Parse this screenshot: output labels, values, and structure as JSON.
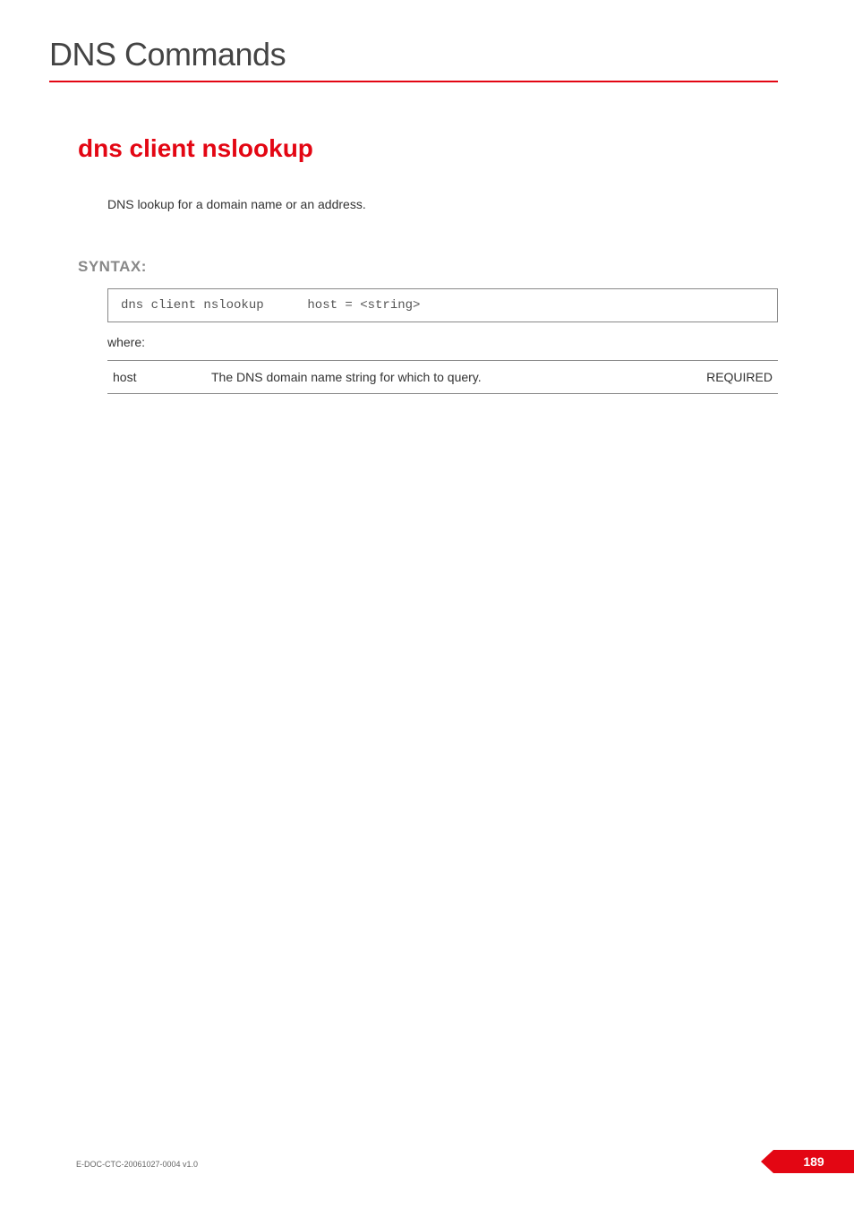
{
  "header": {
    "title": "DNS Commands"
  },
  "section": {
    "title": "dns client nslookup",
    "description": "DNS lookup for a domain name or an address."
  },
  "syntax": {
    "label": "SYNTAX:",
    "command": "dns client nslookup",
    "parameter": "host = <string>",
    "where_label": "where:"
  },
  "params": [
    {
      "name": "host",
      "description": "The DNS domain name string for which to query.",
      "required": "REQUIRED"
    }
  ],
  "footer": {
    "doc_id": "E-DOC-CTC-20061027-0004 v1.0",
    "page_number": "189"
  }
}
